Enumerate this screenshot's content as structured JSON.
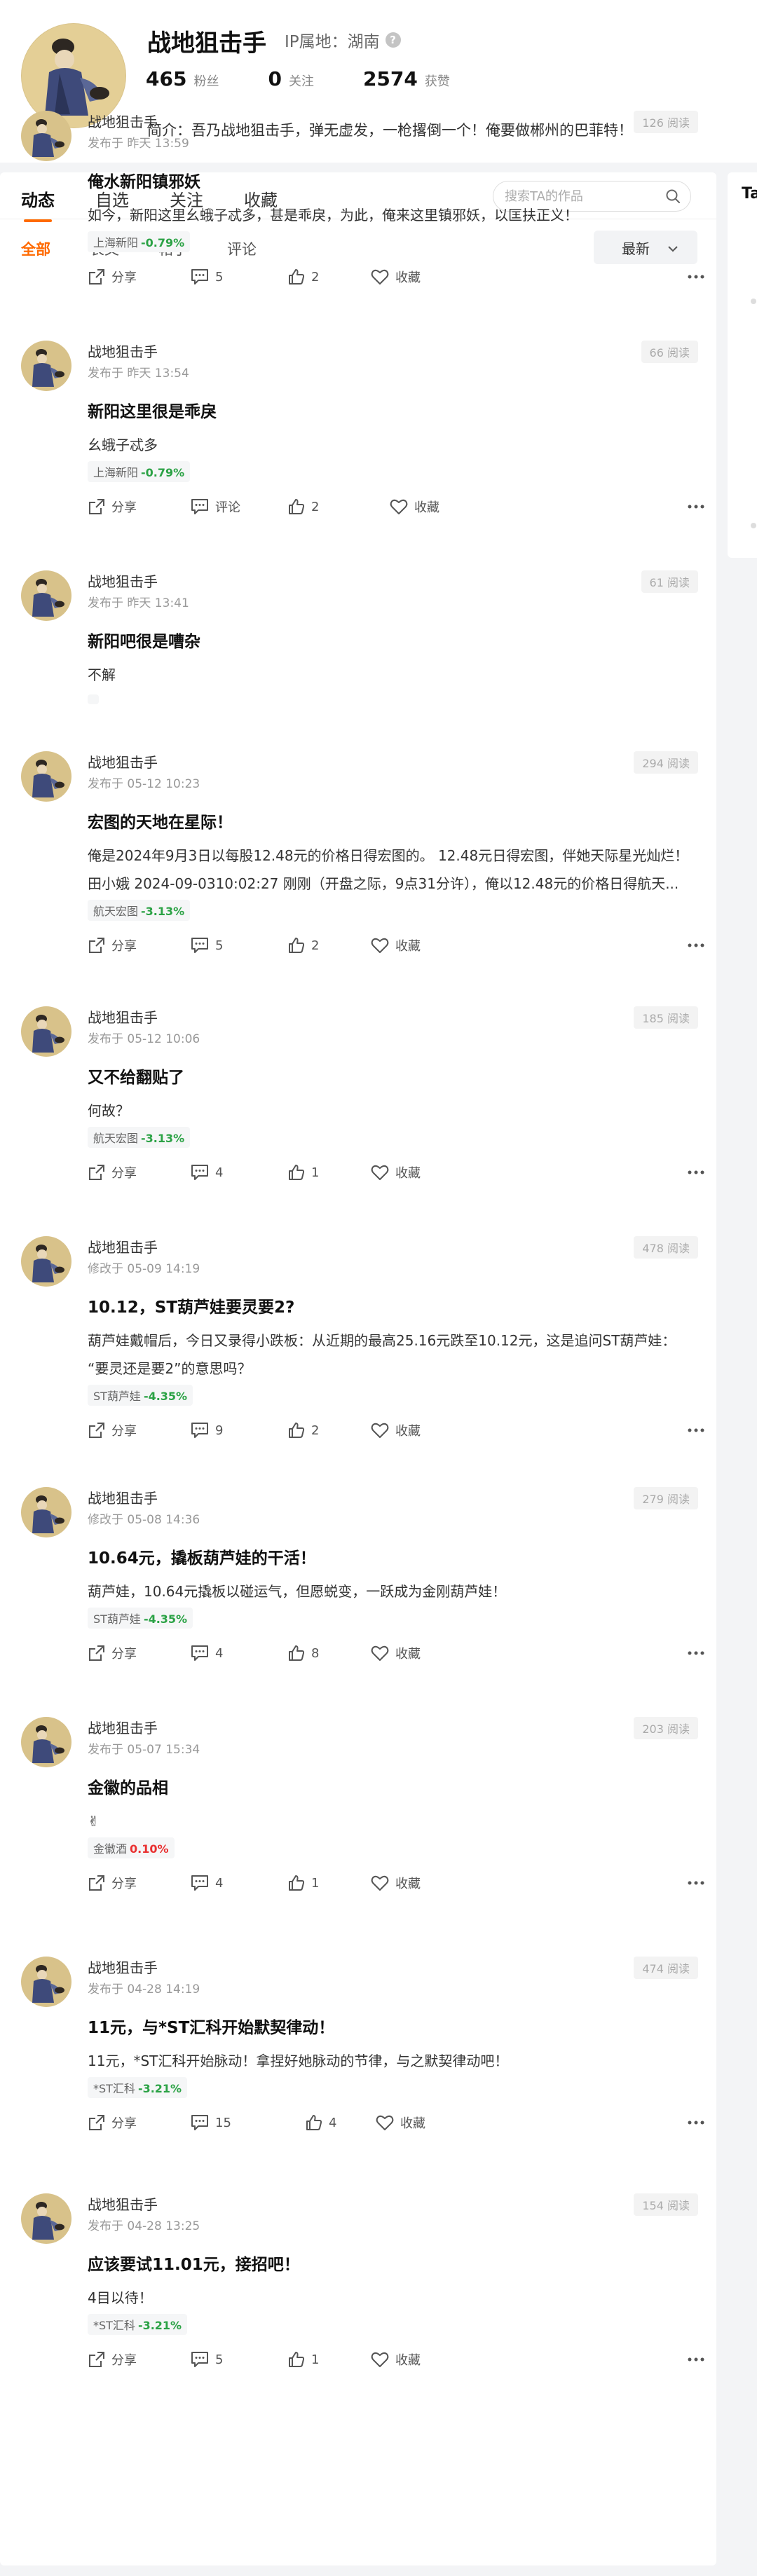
{
  "profile": {
    "name": "战地狙击手",
    "ip_label": "IP属地：湖南",
    "fans_count": "465",
    "fans_label": "粉丝",
    "follow_count": "0",
    "follow_label": "关注",
    "likes_count": "2574",
    "likes_label": "获赞",
    "bio": "简介：吾乃战地狙击手，弹无虚发，一枪撂倒一个！俺要做郴州的巴菲特！"
  },
  "tabs": [
    "动态",
    "自选",
    "关注",
    "收藏"
  ],
  "search": {
    "placeholder": "搜索TA的作品"
  },
  "subtabs": [
    "全部",
    "长文",
    "帖子",
    "评论"
  ],
  "sort": {
    "selected": "最新"
  },
  "right_panel": {
    "title": "Ta"
  },
  "actions": {
    "share": "分享",
    "favorite": "收藏",
    "comment_empty": "评论"
  },
  "colors": {
    "accent": "#ff6a00",
    "stock_down": "#2ba245",
    "stock_up": "#e93030"
  },
  "posts": [
    {
      "author": "战地狙击手",
      "time": "发布于 昨天 13:59",
      "views": "126 阅读",
      "title": "俺水新阳镇邪妖",
      "body": "如今，新阳这里幺蛾子忒多，甚是乖戾，为此，俺来这里镇邪妖，以匡扶正义！",
      "stock": "上海新阳",
      "change": "-0.79%",
      "direction": "down",
      "comments": "5",
      "likes": "2"
    },
    {
      "author": "战地狙击手",
      "time": "发布于 昨天 13:54",
      "views": "66 阅读",
      "title": "新阳这里很是乖戾",
      "body": "幺蛾子忒多",
      "stock": "上海新阳",
      "change": "-0.79%",
      "direction": "down",
      "comments": "评论",
      "likes": "2"
    },
    {
      "author": "战地狙击手",
      "time": "发布于 昨天 13:41",
      "views": "61 阅读",
      "title": "新阳吧很是嘈杂",
      "body": "不解",
      "stock": "",
      "change": "",
      "direction": "down",
      "comments": "",
      "likes": ""
    },
    {
      "author": "战地狙击手",
      "time": "发布于 05-12 10:23",
      "views": "294 阅读",
      "title": "宏图的天地在星际！",
      "body": "俺是2024年9月3日以每股12.48元的价格日得宏图的。 12.48元日得宏图，伴她天际星光灿烂！\n田小娥 2024-09-0310:02:27 刚刚（开盘之际，9点31分许），俺以12.48元的价格日得航天...",
      "stock": "航天宏图",
      "change": "-3.13%",
      "direction": "down",
      "comments": "5",
      "likes": "2"
    },
    {
      "author": "战地狙击手",
      "time": "发布于 05-12 10:06",
      "views": "185 阅读",
      "title": "又不给翻贴了",
      "body": "何故？",
      "stock": "航天宏图",
      "change": "-3.13%",
      "direction": "down",
      "comments": "4",
      "likes": "1"
    },
    {
      "author": "战地狙击手",
      "time": "修改于 05-09 14:19",
      "views": "478 阅读",
      "title": "10.12，ST葫芦娃要灵要2?",
      "body": "葫芦娃戴帽后，今日又录得小跌板：从近期的最高25.16元跌至10.12元，这是追问ST葫芦娃：\n“要灵还是要2”的意思吗？",
      "stock": "ST葫芦娃",
      "change": "-4.35%",
      "direction": "down",
      "comments": "9",
      "likes": "2"
    },
    {
      "author": "战地狙击手",
      "time": "修改于 05-08 14:36",
      "views": "279 阅读",
      "title": "10.64元，撬板葫芦娃的干活！",
      "body": "葫芦娃，10.64元撬板以碰运气，但愿蜕变，一跃成为金刚葫芦娃！",
      "stock": "ST葫芦娃",
      "change": "-4.35%",
      "direction": "down",
      "comments": "4",
      "likes": "8"
    },
    {
      "author": "战地狙击手",
      "time": "发布于 05-07 15:34",
      "views": "203 阅读",
      "title": "金徽的品相",
      "body": "✌",
      "stock": "金徽酒",
      "change": "0.10%",
      "direction": "up",
      "comments": "4",
      "likes": "1"
    },
    {
      "author": "战地狙击手",
      "time": "发布于 04-28 14:19",
      "views": "474 阅读",
      "title": "11元，与*ST汇科开始默契律动！",
      "body": "11元，*ST汇科开始脉动！拿捏好她脉动的节律，与之默契律动吧！",
      "stock": "*ST汇科",
      "change": "-3.21%",
      "direction": "down",
      "comments": "15",
      "likes": "4"
    },
    {
      "author": "战地狙击手",
      "time": "发布于 04-28 13:25",
      "views": "154 阅读",
      "title": "应该要试11.01元，接招吧！",
      "body": "4目以待！",
      "stock": "*ST汇科",
      "change": "-3.21%",
      "direction": "down",
      "comments": "5",
      "likes": "1"
    }
  ]
}
